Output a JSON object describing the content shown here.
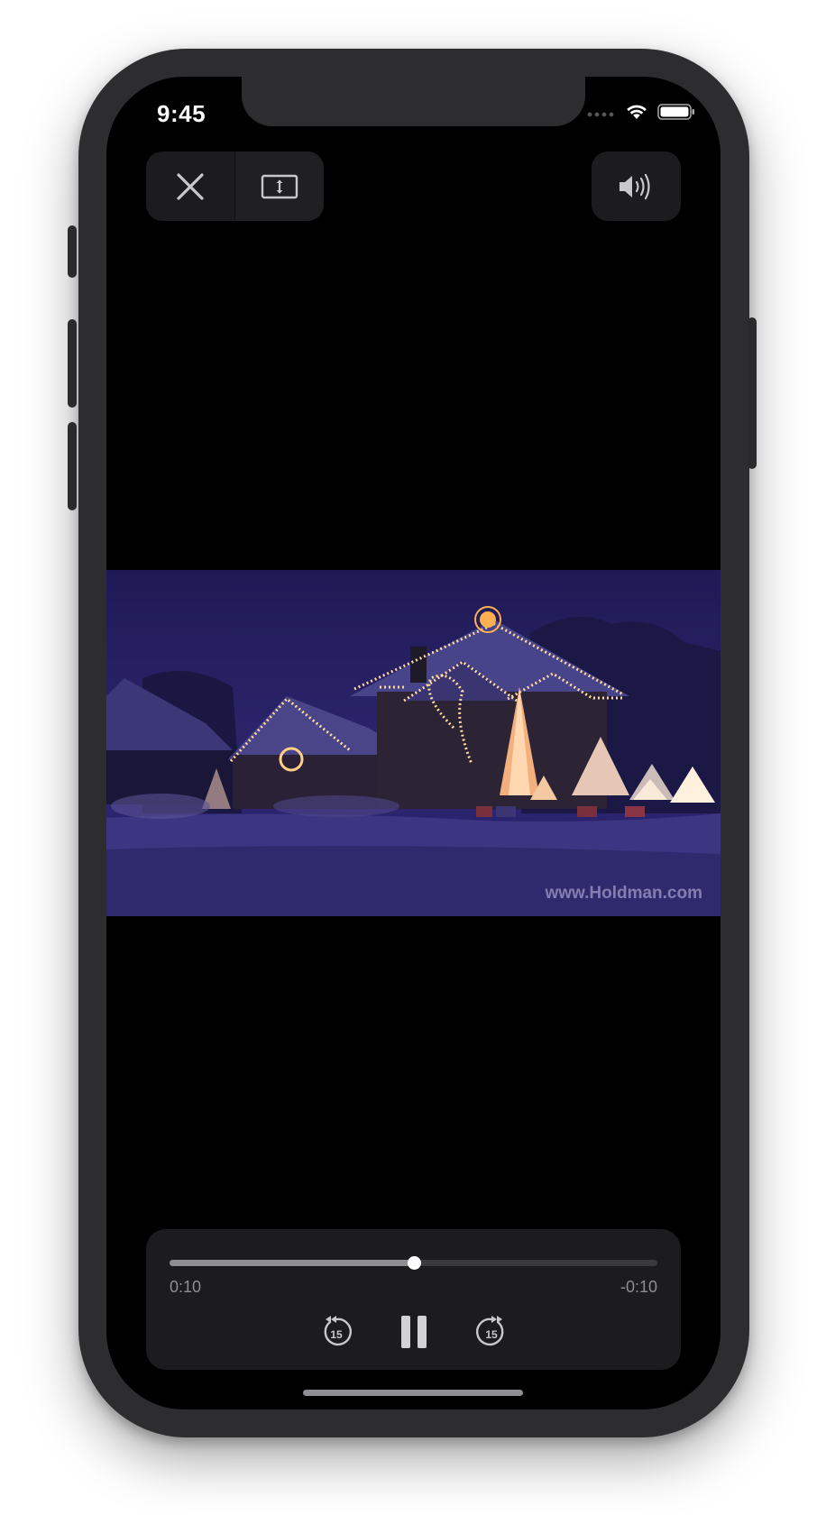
{
  "status_bar": {
    "time": "9:45"
  },
  "top_controls": {
    "close_icon": "close-icon",
    "resize_icon": "aspect-resize-icon",
    "volume_icon": "speaker-volume-icon"
  },
  "video": {
    "watermark": "www.Holdman.com"
  },
  "playback": {
    "elapsed": "0:10",
    "remaining": "-0:10",
    "progress": 0.5,
    "skip_back_seconds": "15",
    "skip_forward_seconds": "15"
  },
  "colors": {
    "screen_bg": "#000000",
    "control_bg": "#1c1c1e",
    "accent_text": "#8e8e93",
    "video_sky": "#2a2369"
  }
}
